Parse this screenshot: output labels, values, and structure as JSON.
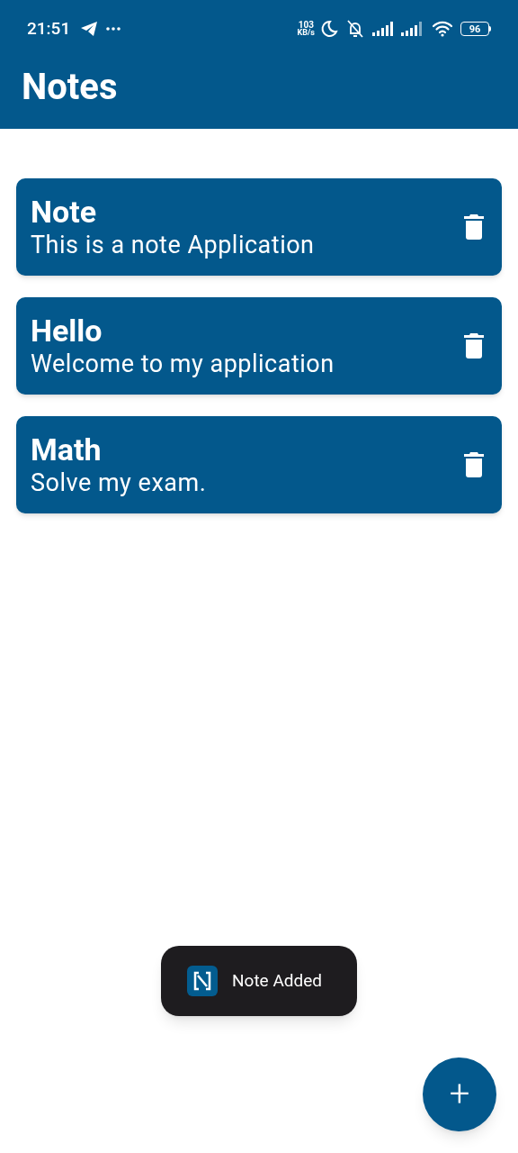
{
  "status_bar": {
    "time": "21:51",
    "speed_value": "103",
    "speed_unit": "KB/s",
    "battery": "96"
  },
  "app_bar": {
    "title": "Notes"
  },
  "notes": [
    {
      "title": "Note",
      "body": "This is a note Application"
    },
    {
      "title": "Hello",
      "body": "Welcome to my application"
    },
    {
      "title": "Math",
      "body": "Solve my exam."
    }
  ],
  "toast": {
    "message": "Note Added"
  },
  "fab": {
    "label": "+"
  }
}
